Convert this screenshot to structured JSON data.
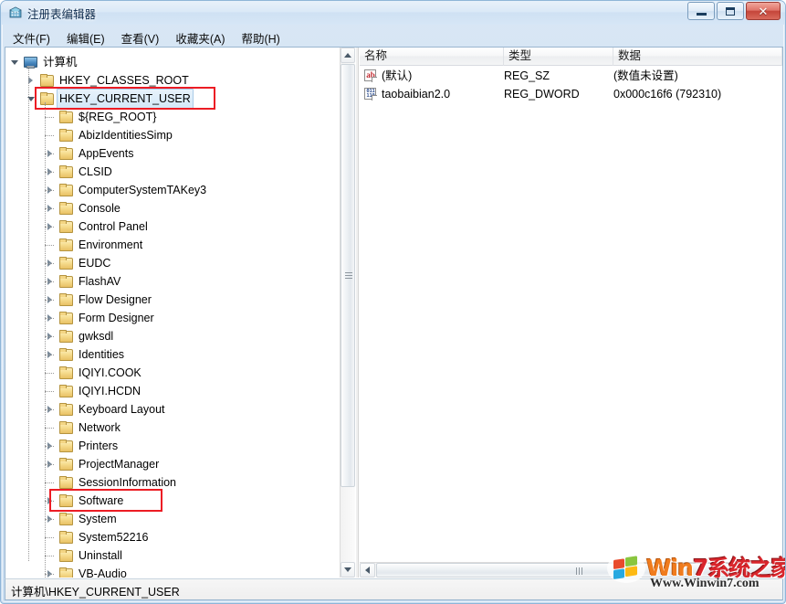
{
  "window": {
    "title": "注册表编辑器",
    "icon": "registry-editor-icon",
    "controls": {
      "minimize": "–",
      "maximize": "□",
      "close": "✕"
    }
  },
  "menubar": {
    "items": [
      {
        "label": "文件(F)",
        "name": "menu-file"
      },
      {
        "label": "编辑(E)",
        "name": "menu-edit"
      },
      {
        "label": "查看(V)",
        "name": "menu-view"
      },
      {
        "label": "收藏夹(A)",
        "name": "menu-favorites"
      },
      {
        "label": "帮助(H)",
        "name": "menu-help"
      }
    ]
  },
  "tree": {
    "items": [
      {
        "label": "计算机",
        "depth": 0,
        "icon": "computer",
        "expander": "expanded",
        "selected": false,
        "highlighted": false
      },
      {
        "label": "HKEY_CLASSES_ROOT",
        "depth": 1,
        "icon": "folder",
        "expander": "collapsed",
        "selected": false,
        "highlighted": false
      },
      {
        "label": "HKEY_CURRENT_USER",
        "depth": 1,
        "icon": "folder",
        "expander": "expanded",
        "selected": true,
        "highlighted": true
      },
      {
        "label": "${REG_ROOT}",
        "depth": 2,
        "icon": "folder",
        "expander": "none",
        "selected": false,
        "highlighted": false
      },
      {
        "label": "AbizIdentitiesSimp",
        "depth": 2,
        "icon": "folder",
        "expander": "none",
        "selected": false,
        "highlighted": false
      },
      {
        "label": "AppEvents",
        "depth": 2,
        "icon": "folder",
        "expander": "collapsed",
        "selected": false,
        "highlighted": false
      },
      {
        "label": "CLSID",
        "depth": 2,
        "icon": "folder",
        "expander": "collapsed",
        "selected": false,
        "highlighted": false
      },
      {
        "label": "ComputerSystemTAKey3",
        "depth": 2,
        "icon": "folder",
        "expander": "collapsed",
        "selected": false,
        "highlighted": false
      },
      {
        "label": "Console",
        "depth": 2,
        "icon": "folder",
        "expander": "collapsed",
        "selected": false,
        "highlighted": false
      },
      {
        "label": "Control Panel",
        "depth": 2,
        "icon": "folder",
        "expander": "collapsed",
        "selected": false,
        "highlighted": false
      },
      {
        "label": "Environment",
        "depth": 2,
        "icon": "folder",
        "expander": "none",
        "selected": false,
        "highlighted": false
      },
      {
        "label": "EUDC",
        "depth": 2,
        "icon": "folder",
        "expander": "collapsed",
        "selected": false,
        "highlighted": false
      },
      {
        "label": "FlashAV",
        "depth": 2,
        "icon": "folder",
        "expander": "collapsed",
        "selected": false,
        "highlighted": false
      },
      {
        "label": "Flow Designer",
        "depth": 2,
        "icon": "folder",
        "expander": "collapsed",
        "selected": false,
        "highlighted": false
      },
      {
        "label": "Form Designer",
        "depth": 2,
        "icon": "folder",
        "expander": "collapsed",
        "selected": false,
        "highlighted": false
      },
      {
        "label": "gwksdl",
        "depth": 2,
        "icon": "folder",
        "expander": "collapsed",
        "selected": false,
        "highlighted": false
      },
      {
        "label": "Identities",
        "depth": 2,
        "icon": "folder",
        "expander": "collapsed",
        "selected": false,
        "highlighted": false
      },
      {
        "label": "IQIYI.COOK",
        "depth": 2,
        "icon": "folder",
        "expander": "none",
        "selected": false,
        "highlighted": false
      },
      {
        "label": "IQIYI.HCDN",
        "depth": 2,
        "icon": "folder",
        "expander": "none",
        "selected": false,
        "highlighted": false
      },
      {
        "label": "Keyboard Layout",
        "depth": 2,
        "icon": "folder",
        "expander": "collapsed",
        "selected": false,
        "highlighted": false
      },
      {
        "label": "Network",
        "depth": 2,
        "icon": "folder",
        "expander": "none",
        "selected": false,
        "highlighted": false
      },
      {
        "label": "Printers",
        "depth": 2,
        "icon": "folder",
        "expander": "collapsed",
        "selected": false,
        "highlighted": false
      },
      {
        "label": "ProjectManager",
        "depth": 2,
        "icon": "folder",
        "expander": "collapsed",
        "selected": false,
        "highlighted": false
      },
      {
        "label": "SessionInformation",
        "depth": 2,
        "icon": "folder",
        "expander": "none",
        "selected": false,
        "highlighted": false
      },
      {
        "label": "Software",
        "depth": 2,
        "icon": "folder",
        "expander": "collapsed",
        "selected": false,
        "highlighted": true
      },
      {
        "label": "System",
        "depth": 2,
        "icon": "folder",
        "expander": "collapsed",
        "selected": false,
        "highlighted": false
      },
      {
        "label": "System52216",
        "depth": 2,
        "icon": "folder",
        "expander": "none",
        "selected": false,
        "highlighted": false
      },
      {
        "label": "Uninstall",
        "depth": 2,
        "icon": "folder",
        "expander": "none",
        "selected": false,
        "highlighted": false
      },
      {
        "label": "VB-Audio",
        "depth": 2,
        "icon": "folder",
        "expander": "collapsed",
        "selected": false,
        "highlighted": false
      }
    ]
  },
  "list": {
    "columns": [
      {
        "label": "名称",
        "width": 158
      },
      {
        "label": "类型",
        "width": 120
      },
      {
        "label": "数据",
        "width": 185
      }
    ],
    "rows": [
      {
        "icon": "reg-sz-icon",
        "icon_glyph": "ab",
        "name": "(默认)",
        "type": "REG_SZ",
        "data": "(数值未设置)"
      },
      {
        "icon": "reg-dword-icon",
        "icon_glyph_line1": "011",
        "icon_glyph_line2": "110",
        "name": "taobaibian2.0",
        "type": "REG_DWORD",
        "data": "0x000c16f6 (792310)"
      }
    ]
  },
  "statusbar": {
    "path": "计算机\\HKEY_CURRENT_USER"
  },
  "watermark": {
    "brand_w": "Win",
    "brand_7": "7",
    "brand_cn": "系统之家",
    "url": "Www.Winwin7.com"
  },
  "colors": {
    "annotation_red": "#ec1c24",
    "title_blue": "#0c2a4d",
    "close_red": "#c4453a",
    "selection_blue": "#d4e8f8",
    "watermark_orange": "#f07c1e",
    "watermark_red": "#d9262c"
  }
}
